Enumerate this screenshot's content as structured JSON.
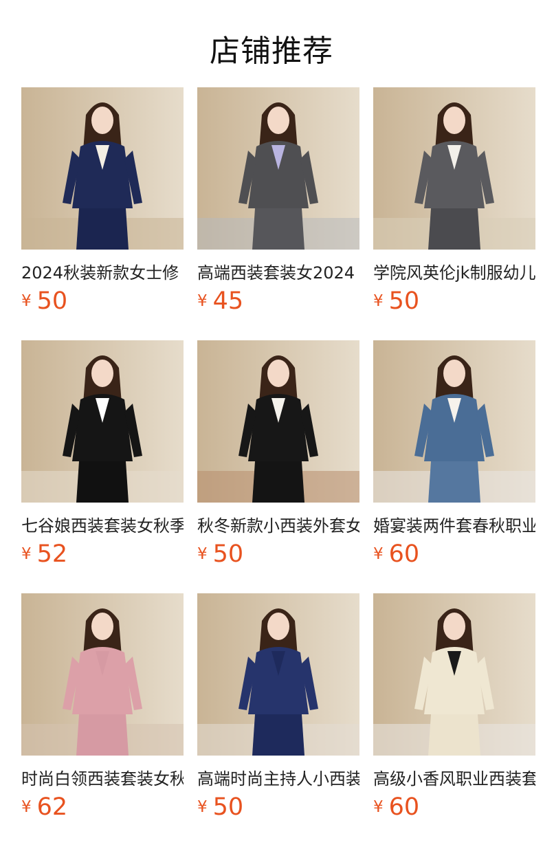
{
  "header": {
    "title": "店铺推荐"
  },
  "products": [
    {
      "name": "2024秋装新款女士修",
      "currency": "¥",
      "price": "50",
      "colors": {
        "bg": "#c9b495",
        "bg2": "#e6dccb",
        "top": "#1f2a57",
        "bottom": "#1b2550",
        "inner": "#f4efe4"
      }
    },
    {
      "name": "高端西装套装女2024",
      "currency": "¥",
      "price": "45",
      "colors": {
        "bg": "#b8b9bc",
        "bg2": "#dcdcdf",
        "top": "#4f4f52",
        "bottom": "#56565a",
        "inner": "#b9b4e0"
      }
    },
    {
      "name": "学院风英伦jk制服幼儿",
      "currency": "¥",
      "price": "50",
      "colors": {
        "bg": "#d9cdb8",
        "bg2": "#efe9de",
        "top": "#5a5a5e",
        "bottom": "#4b4b4f",
        "inner": "#f3f0ea"
      }
    },
    {
      "name": "七谷娘西装套装女秋季",
      "currency": "¥",
      "price": "52",
      "colors": {
        "bg": "#e6dccd",
        "bg2": "#f4efe6",
        "top": "#151515",
        "bottom": "#111111",
        "inner": "#ffffff"
      }
    },
    {
      "name": "秋冬新款小西装外套女",
      "currency": "¥",
      "price": "50",
      "colors": {
        "bg": "#b88e6e",
        "bg2": "#d8c8b8",
        "top": "#171717",
        "bottom": "#141414",
        "inner": "#f5f2ec"
      }
    },
    {
      "name": "婚宴装两件套春秋职业",
      "currency": "¥",
      "price": "60",
      "colors": {
        "bg": "#e9e6e2",
        "bg2": "#f7f6f4",
        "top": "#4a6d96",
        "bottom": "#55779f",
        "inner": "#f6f2ec"
      }
    },
    {
      "name": "时尚白领西装套装女秋",
      "currency": "¥",
      "price": "62",
      "colors": {
        "bg": "#d6c2b0",
        "bg2": "#eee4da",
        "top": "#dca0a8",
        "bottom": "#d69aa3",
        "inner": "#d69aa3"
      }
    },
    {
      "name": "高端时尚主持人小西装",
      "currency": "¥",
      "price": "50",
      "colors": {
        "bg": "#e4ddd4",
        "bg2": "#f3efea",
        "top": "#26346c",
        "bottom": "#1e2a5c",
        "inner": "#1e2a5c"
      }
    },
    {
      "name": "高级小香风职业西装套",
      "currency": "¥",
      "price": "60",
      "colors": {
        "bg": "#e9e6e2",
        "bg2": "#f7f6f4",
        "top": "#efe7d2",
        "bottom": "#ece3cd",
        "inner": "#1a1a1a"
      }
    }
  ]
}
